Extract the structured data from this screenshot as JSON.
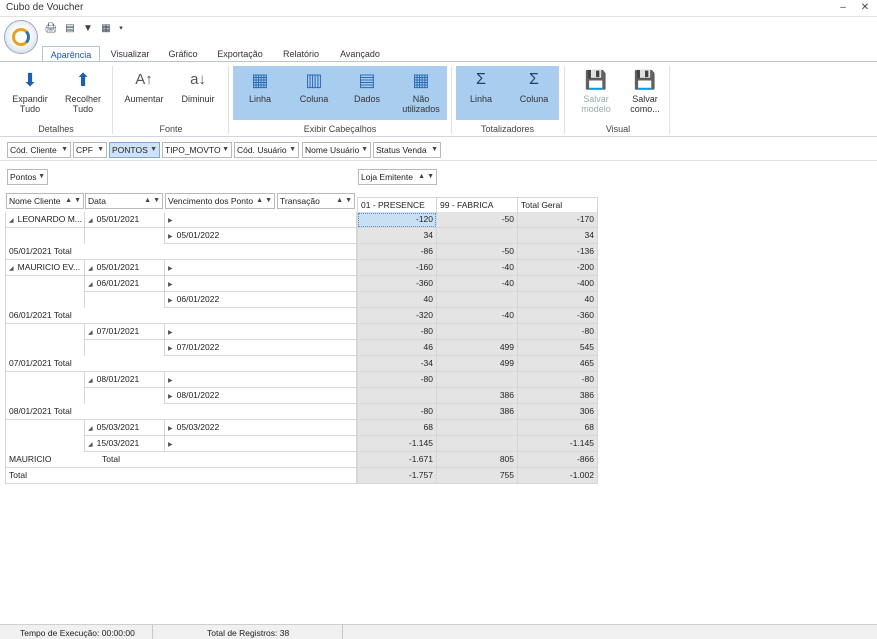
{
  "window": {
    "title": "Cubo de Voucher"
  },
  "ribbon": {
    "tabs": [
      "Aparência",
      "Visualizar",
      "Gráfico",
      "Exportação",
      "Relatório",
      "Avançado"
    ],
    "buttons": {
      "expandir": "Expandir Tudo",
      "recolher": "Recolher Tudo",
      "aumentar": "Aumentar",
      "diminuir": "Diminuir",
      "linha": "Linha",
      "coluna": "Coluna",
      "dados": "Dados",
      "nao_utilizados": "Não utilizados",
      "tot_linha": "Linha",
      "tot_coluna": "Coluna",
      "salvar_modelo": "Salvar modelo",
      "salvar_como": "Salvar como..."
    },
    "groups": {
      "detalhes": "Detalhes",
      "fonte": "Fonte",
      "exibir": "Exibir Cabeçalhos",
      "totalizadores": "Totalizadores",
      "visual": "Visual"
    }
  },
  "filters": [
    "Cód. Cliente",
    "CPF",
    "PONTOS",
    "TIPO_MOVTO",
    "Cód. Usuário",
    "Nome Usuário",
    "Status Venda"
  ],
  "data_field": "Pontos",
  "column_field": "Loja Emitente",
  "row_headers": [
    "Nome Cliente",
    "Data",
    "Vencimento dos Ponto",
    "Transação"
  ],
  "col_headers": [
    "01 - PRESENCE",
    "99 - FABRICA",
    "Total Geral"
  ],
  "rows": [
    {
      "c": "LEONARDO M...",
      "d": "05/01/2021",
      "v": "",
      "p": "-120",
      "f": "-50",
      "t": "-170"
    },
    {
      "c": "",
      "d": "",
      "v": "05/01/2022",
      "p": "34",
      "f": "",
      "t": "34"
    },
    {
      "c": "05/01/2021 Total",
      "d": "",
      "v": "",
      "p": "-86",
      "f": "-50",
      "t": "-136"
    },
    {
      "c": "MAURICIO EV...",
      "d": "05/01/2021",
      "v": "",
      "p": "-160",
      "f": "-40",
      "t": "-200"
    },
    {
      "c": "",
      "d": "06/01/2021",
      "v": "",
      "p": "-360",
      "f": "-40",
      "t": "-400"
    },
    {
      "c": "",
      "d": "",
      "v": "06/01/2022",
      "p": "40",
      "f": "",
      "t": "40"
    },
    {
      "c": "06/01/2021 Total",
      "d": "",
      "v": "",
      "p": "-320",
      "f": "-40",
      "t": "-360"
    },
    {
      "c": "",
      "d": "07/01/2021",
      "v": "",
      "p": "-80",
      "f": "",
      "t": "-80"
    },
    {
      "c": "",
      "d": "",
      "v": "07/01/2022",
      "p": "46",
      "f": "499",
      "t": "545"
    },
    {
      "c": "07/01/2021 Total",
      "d": "",
      "v": "",
      "p": "-34",
      "f": "499",
      "t": "465"
    },
    {
      "c": "",
      "d": "08/01/2021",
      "v": "",
      "p": "-80",
      "f": "",
      "t": "-80"
    },
    {
      "c": "",
      "d": "",
      "v": "08/01/2022",
      "p": "",
      "f": "386",
      "t": "386"
    },
    {
      "c": "08/01/2021 Total",
      "d": "",
      "v": "",
      "p": "-80",
      "f": "386",
      "t": "306"
    },
    {
      "c": "",
      "d": "05/03/2021",
      "v": "05/03/2022",
      "p": "68",
      "f": "",
      "t": "68"
    },
    {
      "c": "",
      "d": "15/03/2021",
      "v": "",
      "p": "-1.145",
      "f": "",
      "t": "-1.145"
    },
    {
      "c": "MAURICIO",
      "d": "Total",
      "v": "",
      "p": "-1.671",
      "f": "805",
      "t": "-866"
    },
    {
      "c": "Total",
      "d": "",
      "v": "",
      "p": "-1.757",
      "f": "755",
      "t": "-1.002"
    }
  ],
  "status": {
    "exec_time": "Tempo de Execução: 00:00:00",
    "total_records": "Total de Registros: 38"
  }
}
